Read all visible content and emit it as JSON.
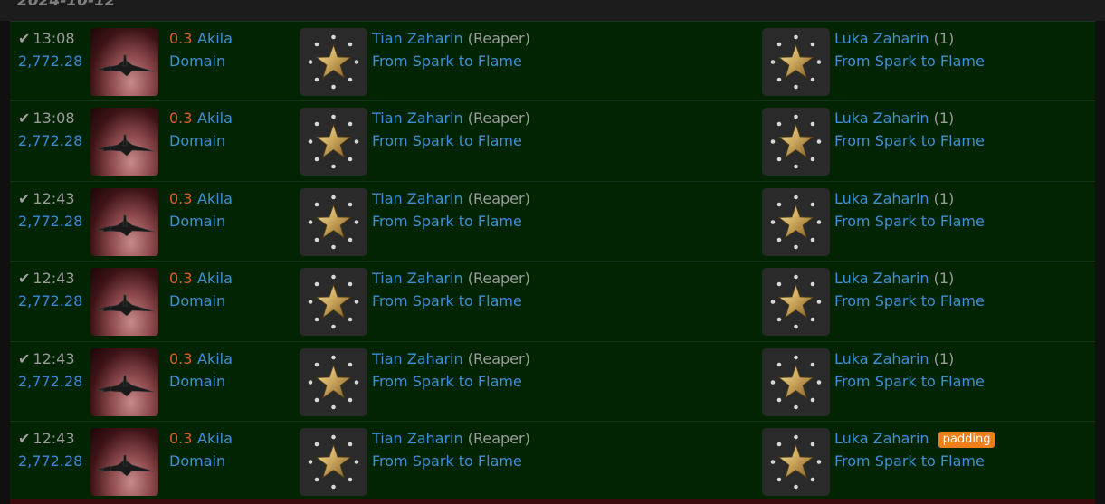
{
  "date_header": "2024-10-12",
  "colors": {
    "accent_link": "#3e8fd8",
    "security_low": "#e35b2a",
    "row_bg": "#032403",
    "badge": "#ef7f1a"
  },
  "icons": {
    "check": "checkmark-icon",
    "victim_ship": "ship-render-image",
    "corporation": "corporation-star-logo"
  },
  "kills": [
    {
      "time": "13:08",
      "value": "2,772.28",
      "security": "0.3",
      "system": "Akila",
      "region": "Domain",
      "victim_name": "Tian Zaharin",
      "victim_ship": "(Reaper)",
      "victim_corp": "From Spark to Flame",
      "killer_name": "Luka Zaharin",
      "killer_count": "(1)",
      "killer_corp": "From Spark to Flame",
      "killer_badge": ""
    },
    {
      "time": "13:08",
      "value": "2,772.28",
      "security": "0.3",
      "system": "Akila",
      "region": "Domain",
      "victim_name": "Tian Zaharin",
      "victim_ship": "(Reaper)",
      "victim_corp": "From Spark to Flame",
      "killer_name": "Luka Zaharin",
      "killer_count": "(1)",
      "killer_corp": "From Spark to Flame",
      "killer_badge": ""
    },
    {
      "time": "12:43",
      "value": "2,772.28",
      "security": "0.3",
      "system": "Akila",
      "region": "Domain",
      "victim_name": "Tian Zaharin",
      "victim_ship": "(Reaper)",
      "victim_corp": "From Spark to Flame",
      "killer_name": "Luka Zaharin",
      "killer_count": "(1)",
      "killer_corp": "From Spark to Flame",
      "killer_badge": ""
    },
    {
      "time": "12:43",
      "value": "2,772.28",
      "security": "0.3",
      "system": "Akila",
      "region": "Domain",
      "victim_name": "Tian Zaharin",
      "victim_ship": "(Reaper)",
      "victim_corp": "From Spark to Flame",
      "killer_name": "Luka Zaharin",
      "killer_count": "(1)",
      "killer_corp": "From Spark to Flame",
      "killer_badge": ""
    },
    {
      "time": "12:43",
      "value": "2,772.28",
      "security": "0.3",
      "system": "Akila",
      "region": "Domain",
      "victim_name": "Tian Zaharin",
      "victim_ship": "(Reaper)",
      "victim_corp": "From Spark to Flame",
      "killer_name": "Luka Zaharin",
      "killer_count": "(1)",
      "killer_corp": "From Spark to Flame",
      "killer_badge": ""
    },
    {
      "time": "12:43",
      "value": "2,772.28",
      "security": "0.3",
      "system": "Akila",
      "region": "Domain",
      "victim_name": "Tian Zaharin",
      "victim_ship": "(Reaper)",
      "victim_corp": "From Spark to Flame",
      "killer_name": "Luka Zaharin",
      "killer_count": "",
      "killer_corp": "From Spark to Flame",
      "killer_badge": "padding"
    }
  ]
}
